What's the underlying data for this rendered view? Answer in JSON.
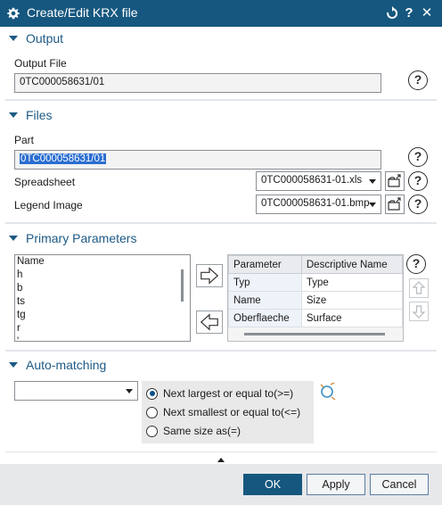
{
  "window": {
    "title": "Create/Edit KRX file"
  },
  "output": {
    "section_title": "Output",
    "file_label": "Output File",
    "file_value": "0TC000058631/01"
  },
  "files": {
    "section_title": "Files",
    "part_label": "Part",
    "part_value": "0TC000058631/01",
    "spreadsheet_label": "Spreadsheet",
    "spreadsheet_value": "0TC000058631-01.xls",
    "legend_label": "Legend Image",
    "legend_value": "0TC000058631-01.bmp"
  },
  "primary": {
    "section_title": "Primary Parameters",
    "list_items": [
      "Name",
      "h",
      "b",
      "ts",
      "tg",
      "r",
      "'"
    ],
    "columns": [
      "Parameter",
      "Descriptive Name"
    ],
    "rows": [
      [
        "Typ",
        "Type"
      ],
      [
        "Name",
        "Size"
      ],
      [
        "Oberflaeche",
        "Surface"
      ]
    ]
  },
  "auto": {
    "section_title": "Auto-matching",
    "dropdown_value": "",
    "options": [
      "Next largest or equal to(>=)",
      "Next smallest or equal to(<=)",
      "Same size as(=)"
    ],
    "selected_index": 0
  },
  "buttons": {
    "ok": "OK",
    "apply": "Apply",
    "cancel": "Cancel"
  },
  "help_symbol": "?",
  "colors": {
    "title_bar": "#16577f",
    "section_text": "#1d5a86",
    "ok_button": "#16577f"
  }
}
